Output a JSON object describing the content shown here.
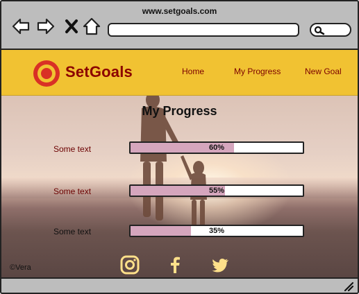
{
  "browser": {
    "url": "www.setgoals.com",
    "icons": [
      "back-arrow-icon",
      "forward-arrow-icon",
      "close-icon",
      "home-icon",
      "search-icon",
      "resize-grip-icon"
    ]
  },
  "site": {
    "brand": "SetGoals",
    "colors": {
      "header": "#f1c232",
      "brand": "#8b0000",
      "accent": "#d5a6bd",
      "logo_red": "#d93025"
    },
    "nav": [
      {
        "label": "Home"
      },
      {
        "label": "My Progress"
      },
      {
        "label": "New Goal"
      }
    ]
  },
  "main": {
    "title": "My Progress",
    "goals": [
      {
        "label": "Some text",
        "progress_text": "60%",
        "progress": 0.6
      },
      {
        "label": "Some text",
        "progress_text": "55%",
        "progress": 0.55
      },
      {
        "label": "Some text",
        "progress_text": "35%",
        "progress": 0.35
      }
    ]
  },
  "footer": {
    "copyright": "©Vera",
    "social": [
      "instagram-icon",
      "facebook-icon",
      "twitter-icon"
    ]
  }
}
